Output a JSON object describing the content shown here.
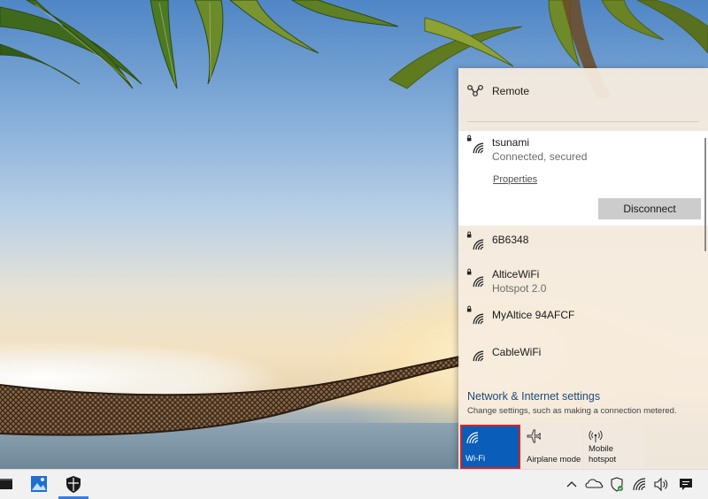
{
  "flyout": {
    "remote_label": "Remote",
    "connected_network": {
      "name": "tsunami",
      "status": "Connected, secured",
      "properties_label": "Properties",
      "disconnect_label": "Disconnect"
    },
    "networks": [
      {
        "name": "6B6348",
        "sub": "",
        "secured": true
      },
      {
        "name": "AlticeWiFi",
        "sub": "Hotspot 2.0",
        "secured": true
      },
      {
        "name": "MyAltice 94AFCF",
        "sub": "",
        "secured": true
      },
      {
        "name": "CableWiFi",
        "sub": "",
        "secured": false
      }
    ],
    "settings_title": "Network & Internet settings",
    "settings_subtitle": "Change settings, such as making a connection metered.",
    "quick_actions": [
      {
        "label": "Wi-Fi",
        "icon": "wifi-icon",
        "active": true
      },
      {
        "label": "Airplane mode",
        "icon": "airplane-icon",
        "active": false
      },
      {
        "label": "Mobile hotspot",
        "icon": "hotspot-icon",
        "active": false
      }
    ]
  },
  "taskbar": {
    "apps": [
      "terminal-icon",
      "photos-icon",
      "security-icon"
    ],
    "tray": [
      "chevron-up-icon",
      "onedrive-icon",
      "defender-icon",
      "wifi-icon",
      "volume-icon",
      "notification-icon"
    ]
  },
  "colors": {
    "accent": "#0a5db8",
    "highlight_border": "#d2232a",
    "link": "#1c4a7a"
  }
}
